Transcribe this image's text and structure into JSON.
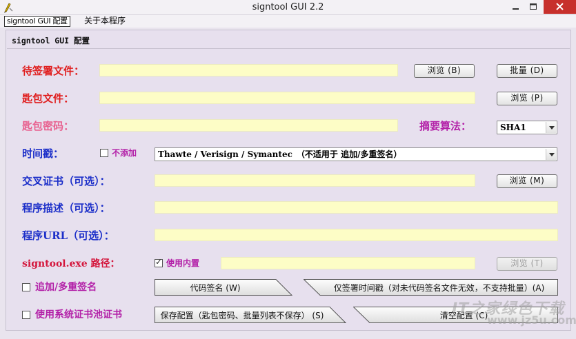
{
  "window": {
    "title": "signtool GUI 2.2"
  },
  "menu": {
    "config": "signtool GUI 配置",
    "about": "关于本程序"
  },
  "panel": {
    "title": "signtool GUI 配置"
  },
  "labels": {
    "file_to_sign": "待签署文件：",
    "key_file": "匙包文件：",
    "key_password": "匙包密码：",
    "digest_algorithm": "摘要算法：",
    "timestamp": "时间戳：",
    "cross_cert": "交叉证书（可选）：",
    "description": "程序描述（可选）：",
    "url": "程序URL（可选）：",
    "signtool_path": "signtool.exe 路径："
  },
  "fields": {
    "file_to_sign": "",
    "key_file": "",
    "key_password": "",
    "cross_cert": "",
    "description": "",
    "url": "",
    "signtool_path": ""
  },
  "buttons": {
    "browse_b": "浏览 (B)",
    "batch_d": "批量 (D)",
    "browse_p": "浏览 (P)",
    "browse_m": "浏览 (M)",
    "browse_t": "浏览 (T)",
    "code_sign": "代码签名 (W)",
    "timestamp_only": "仅签署时间戳（对未代码签名文件无效，不支持批量）(A)",
    "save_config": "保存配置（匙包密码、批量列表不保存） (S)",
    "clear_config": "清空配置 (C)"
  },
  "combos": {
    "digest": "SHA1",
    "timestamp_server": "Thawte / Verisign / Symantec　（不适用于 追加/多重签名）"
  },
  "checkboxes": {
    "no_timestamp": {
      "label": "不添加",
      "checked": false
    },
    "builtin": {
      "label": "使用内置",
      "checked": true
    },
    "append_multi": {
      "label": "追加/多重签名",
      "checked": false
    },
    "system_store": {
      "label": "使用系统证书池证书",
      "checked": false
    }
  },
  "watermark": {
    "line1": "IT之家绿色下载",
    "line2": "www.jz5u.com"
  }
}
